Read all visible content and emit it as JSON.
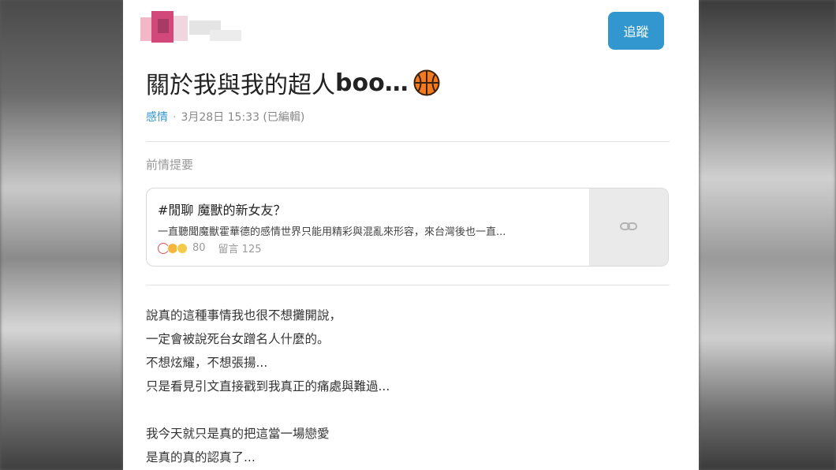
{
  "header": {
    "follow_label": "追蹤"
  },
  "post": {
    "title_main": "關於我與我的超人",
    "title_boo": "boo…",
    "title_icon": "basketball-icon",
    "category": "感情",
    "date": "3月28日 15:33 (已編輯)"
  },
  "previous": {
    "label": "前情提要",
    "card": {
      "title": "#閒聊 魔獸的新女友？",
      "excerpt": "一直聽聞魔獸霍華德的感情世界只能用精彩與混亂來形容，來台灣後也一直...",
      "reaction_count": "80",
      "comments": "留言 125",
      "link_icon": "link-icon"
    }
  },
  "body": {
    "lines": [
      "說真的這種事情我也很不想攤開說，",
      "一定會被說死台女蹭名人什麼的。",
      "不想炫耀，不想張揚...",
      "只是看見引文直接戳到我真正的痛處與難過...",
      "",
      "我今天就只是真的把這當一場戀愛",
      "是真的真的認真了..."
    ]
  },
  "colors": {
    "accent": "#3397cf"
  }
}
